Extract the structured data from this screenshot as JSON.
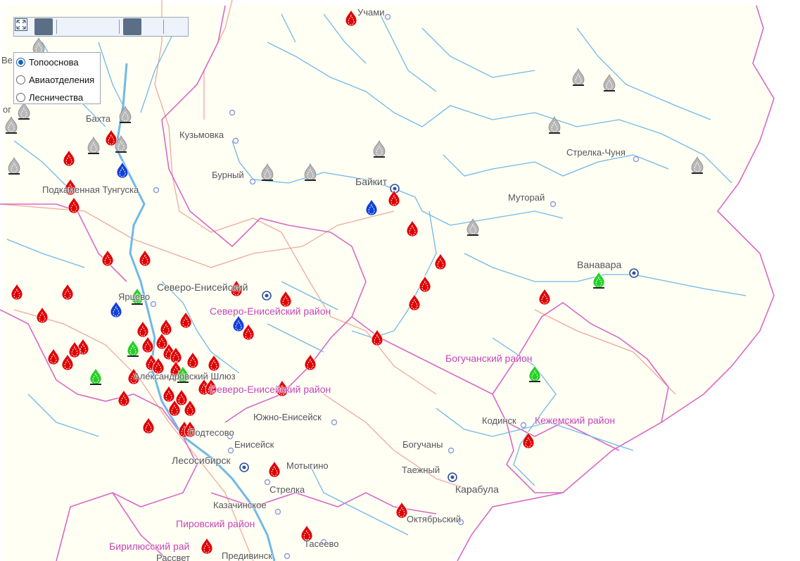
{
  "toolbar": {
    "buttons": [
      {
        "icon": "zoom-extent-icon"
      },
      {
        "icon": "pan-hand-icon"
      },
      {
        "icon": "zoom-box-icon"
      },
      {
        "icon": "zoom-in-icon"
      },
      {
        "icon": "zoom-out-icon"
      },
      {
        "icon": "back-arrow-icon"
      },
      {
        "icon": "forward-arrow-icon"
      },
      {
        "icon": "fullscreen-icon"
      }
    ]
  },
  "layers": {
    "selected": "Топооснова",
    "options": [
      "Топооснова",
      "Авиаотделения",
      "Лесничества"
    ]
  },
  "colors": {
    "background": "#fffff3",
    "river": "#6fb8ea",
    "border": "#d868c8",
    "road": "#f0a8a0",
    "fire_active": "#e00000",
    "fire_grey": "#b8b8b8",
    "fire_green": "#25d025",
    "fire_blue": "#1040d8",
    "town": "#8a9ad8"
  },
  "map": {
    "places": {
      "uchami": "Учами",
      "bakhta": "Бахта",
      "kuzmovka": "Кузьмовка",
      "burny": "Бурный",
      "baikit": "Байкит",
      "strelka_chunya": "Стрелка-Чуня",
      "mutoray": "Муторай",
      "podkamennaya": "Подкаменная Тунгуска",
      "vanavara": "Ванавара",
      "severo_yeniseysky": "Северо-Енисейский",
      "yartsevo": "Ярцево",
      "aleksandrovsky_shlyuz": "Александровский Шлюз",
      "yuzhno_yeniseysk": "Южно-Енисейск",
      "kodinsk": "Кодинск",
      "podtesovo": "Подтесово",
      "yeniseysk": "Енисейск",
      "boguchany": "Богучаны",
      "lesosibirsk": "Лесосибирск",
      "motygino": "Мотыгино",
      "tayozhny": "Таежный",
      "karabula": "Карабула",
      "strelka": "Стрелка",
      "kazachinskoye": "Казачинское",
      "oktyabrsky": "Октябрьский",
      "taseyevo": "Тасеево",
      "predivinsk": "Предивинск",
      "rassvet": "Рассвет",
      "vel": "Ве",
      "og": "ог"
    },
    "regions": {
      "severo_yeniseysky_rayon_1": "Северо-Енисейский район",
      "severo_yeniseysky_rayon_2": "Северо-Енисейский район",
      "boguchansky_rayon": "Богучанский район",
      "kezhemsky_rayon": "Кежемский район",
      "pirovsky_rayon": "Пировский район",
      "birilyussky_rayon": "Бирилюсский рай"
    }
  }
}
